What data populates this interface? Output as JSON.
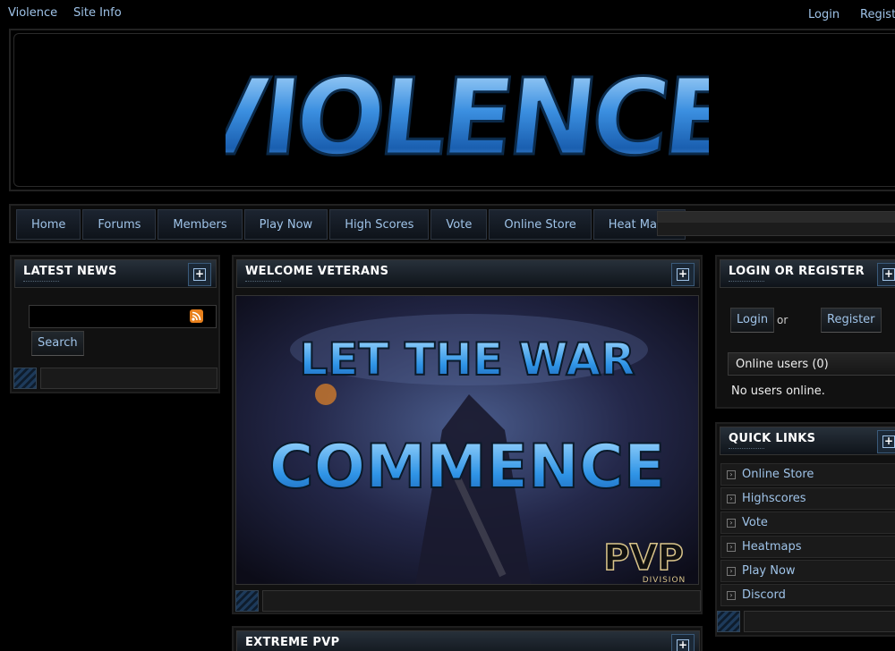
{
  "topbar": {
    "left_links": [
      "Violence",
      "Site Info"
    ],
    "right_links": [
      "Login",
      "Register"
    ]
  },
  "logo_text": "VIOLENCE",
  "nav": [
    "Home",
    "Forums",
    "Members",
    "Play Now",
    "High Scores",
    "Vote",
    "Online Store",
    "Heat Maps"
  ],
  "latest_news": {
    "title": "LATEST NEWS",
    "search_button": "Search"
  },
  "welcome": {
    "title": "WELCOME VETERANS",
    "hero_line1": "LET THE WAR",
    "hero_line2": "COMMENCE",
    "hero_badge": "PVP",
    "hero_badge_sub": "DIVISION"
  },
  "extreme": {
    "title": "EXTREME PVP"
  },
  "login_panel": {
    "title": "LOGIN OR REGISTER",
    "login_button": "Login",
    "or_text": "or",
    "register_button": "Register",
    "online_users_label": "Online users (0)",
    "no_users_text": "No users online."
  },
  "quick_links": {
    "title": "QUICK LINKS",
    "items": [
      "Online Store",
      "Highscores",
      "Vote",
      "Heatmaps",
      "Play Now",
      "Discord"
    ]
  },
  "colors": {
    "link": "#9fc3e8",
    "accent": "#3a8ee8",
    "background": "#000000"
  },
  "icons": {
    "rss": "rss-icon",
    "expand": "plus-icon",
    "arrow": "arrow-right-icon"
  }
}
